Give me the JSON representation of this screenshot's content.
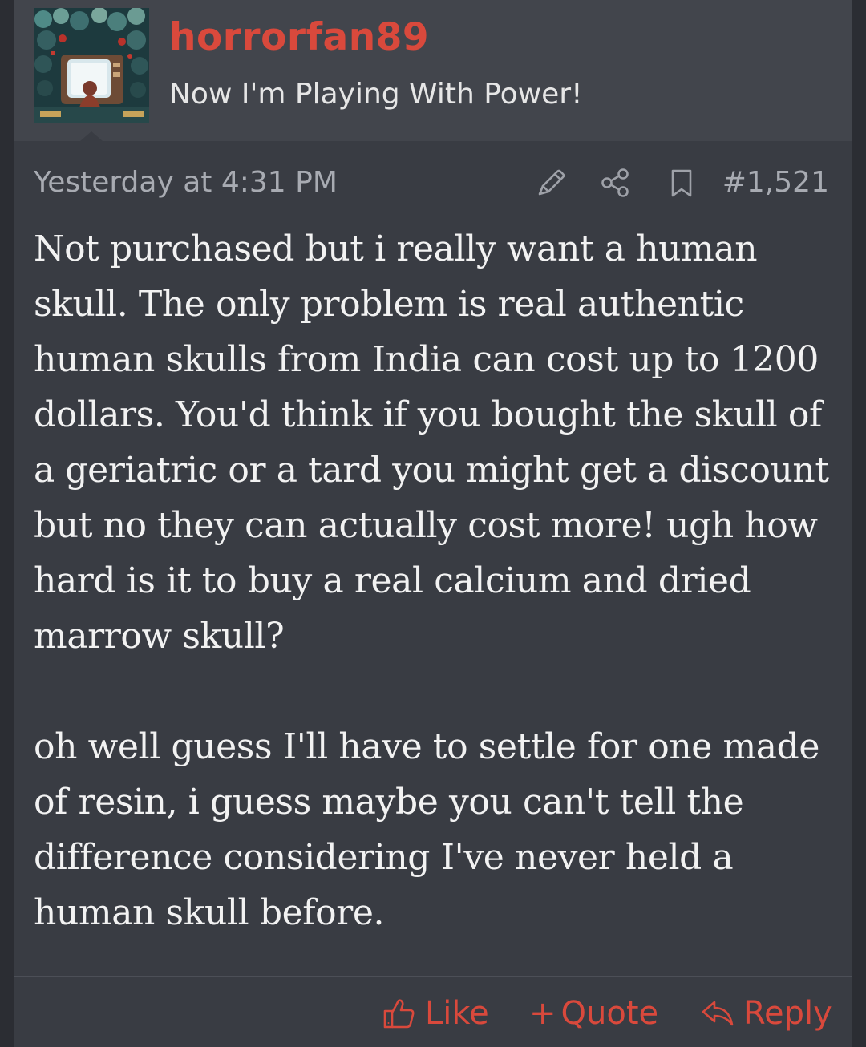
{
  "user": {
    "username": "horrorfan89",
    "title": "Now I'm Playing With Power!"
  },
  "post": {
    "timestamp": "Yesterday at 4:31 PM",
    "number": "#1,521",
    "icons": [
      "edit-pencil-icon",
      "share-icon",
      "bookmark-icon"
    ],
    "paragraphs": [
      "Not purchased but i really want a human skull. The only problem is real authentic human skulls from India can cost up to 1200 dollars. You'd think if you bought the skull of a geriatric or a tard you might get a discount but no they can actually cost more! ugh how hard is it to buy a real calcium and dried marrow skull?",
      "oh well guess I'll have to settle for one made of resin, i guess maybe you can't tell the difference considering I've never held a human skull before."
    ]
  },
  "actions": {
    "like_label": "Like",
    "quote_label": "Quote",
    "quote_prefix": "+",
    "reply_label": "Reply",
    "icons": [
      "thumbs-up-icon",
      "reply-arrow-icon"
    ]
  },
  "colors": {
    "accent": "#d9493c",
    "post_background": "#393c43",
    "header_background": "#42454c",
    "page_background": "#2b2d33",
    "body_text": "#f2f2f2",
    "muted_text": "#a8abb2"
  }
}
